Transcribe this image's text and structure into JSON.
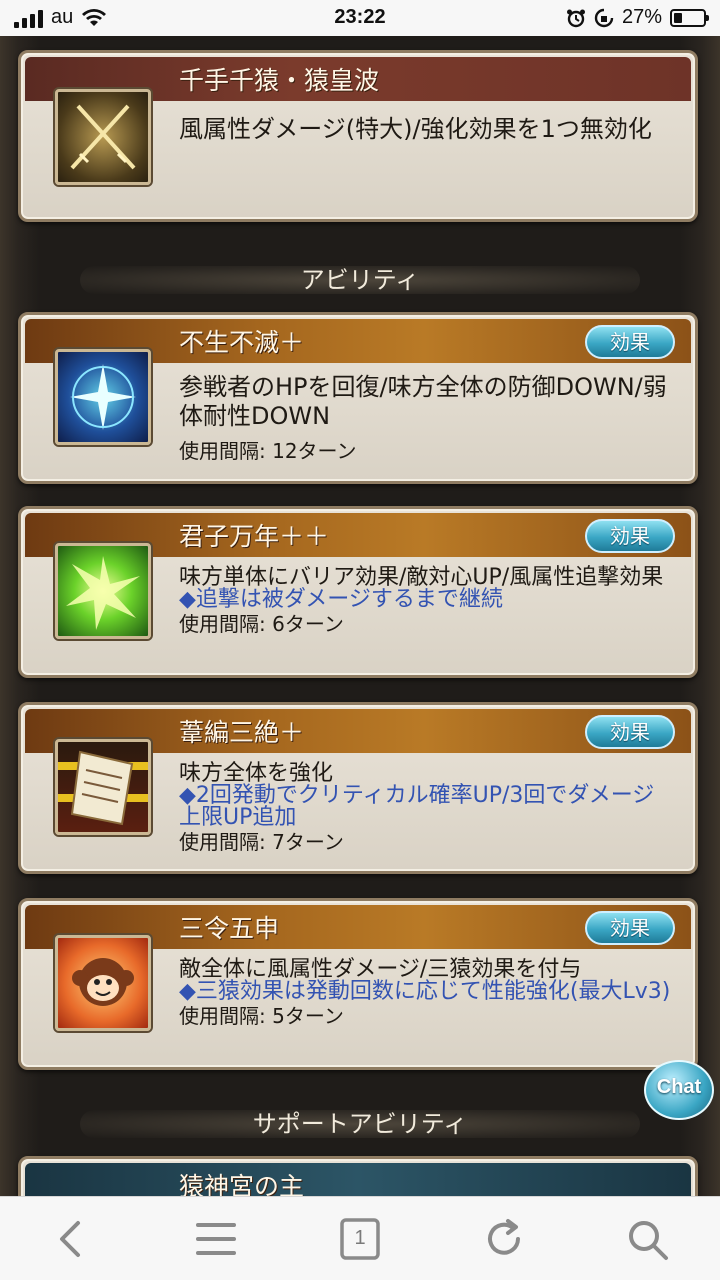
{
  "status_bar": {
    "carrier": "au",
    "time": "23:22",
    "battery_percent": "27%"
  },
  "skill_card": {
    "title": "千手千猿・猿皇波",
    "description": "風属性ダメージ(特大)/強化効果を1つ無効化"
  },
  "sections": {
    "abilities": "アビリティ",
    "support_abilities": "サポートアビリティ"
  },
  "abilities": [
    {
      "title": "不生不滅＋",
      "effect_button": "効果",
      "description": "参戦者のHPを回復/味方全体の防御DOWN/弱体耐性DOWN",
      "note": "",
      "interval": "使用間隔: 12ターン"
    },
    {
      "title": "君子万年＋＋",
      "effect_button": "効果",
      "description": "味方単体にバリア効果/敵対心UP/風属性追撃効果",
      "note": "◆追撃は被ダメージするまで継続",
      "interval": "使用間隔: 6ターン"
    },
    {
      "title": "葦編三絶＋",
      "effect_button": "効果",
      "description": "味方全体を強化",
      "note": "◆2回発動でクリティカル確率UP/3回でダメージ上限UP追加",
      "interval": "使用間隔: 7ターン"
    },
    {
      "title": "三令五申",
      "effect_button": "効果",
      "description": "敵全体に風属性ダメージ/三猿効果を付与",
      "note": "◆三猿効果は発動回数に応じて性能強化(最大Lv3)",
      "interval": "使用間隔: 5ターン"
    }
  ],
  "support_card": {
    "title": "猿神宮の主"
  },
  "chat_button": "Chat",
  "toolbar": {
    "tab_count": "1"
  }
}
